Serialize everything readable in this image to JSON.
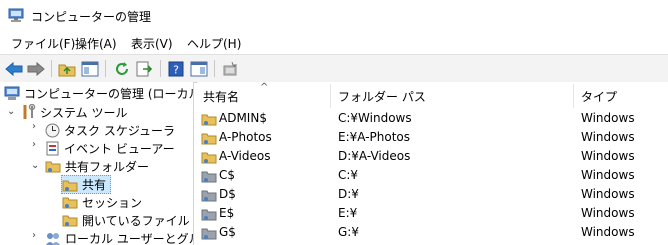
{
  "window": {
    "title": "コンピューターの管理"
  },
  "menu": [
    "ファイル(F)",
    "操作(A)",
    "表示(V)",
    "ヘルプ(H)"
  ],
  "tree": {
    "root": "コンピューターの管理 (ローカル)",
    "system_tools": "システム ツール",
    "task_scheduler": "タスク スケジューラ",
    "event_viewer": "イベント ビューアー",
    "shared_folders": "共有フォルダー",
    "shares": "共有",
    "sessions": "セッション",
    "open_files": "開いているファイル",
    "local_users": "ローカル ユーザーとグループ"
  },
  "columns": {
    "share_name": "共有名",
    "folder_path": "フォルダー パス",
    "type": "タイプ"
  },
  "rows": [
    {
      "name": "ADMIN$",
      "path": "C:¥Windows",
      "type": "Windows"
    },
    {
      "name": "A-Photos",
      "path": "E:¥A-Photos",
      "type": "Windows"
    },
    {
      "name": "A-Videos",
      "path": "D:¥A-Videos",
      "type": "Windows"
    },
    {
      "name": "C$",
      "path": "C:¥",
      "type": "Windows"
    },
    {
      "name": "D$",
      "path": "D:¥",
      "type": "Windows"
    },
    {
      "name": "E$",
      "path": "E:¥",
      "type": "Windows"
    },
    {
      "name": "G$",
      "path": "G:¥",
      "type": "Windows"
    }
  ],
  "icons": [
    "back-icon",
    "forward-icon",
    "up-folder-icon",
    "show-hide-tree-icon",
    "refresh-icon",
    "export-icon",
    "help-icon",
    "properties-icon",
    "new-share-icon"
  ]
}
